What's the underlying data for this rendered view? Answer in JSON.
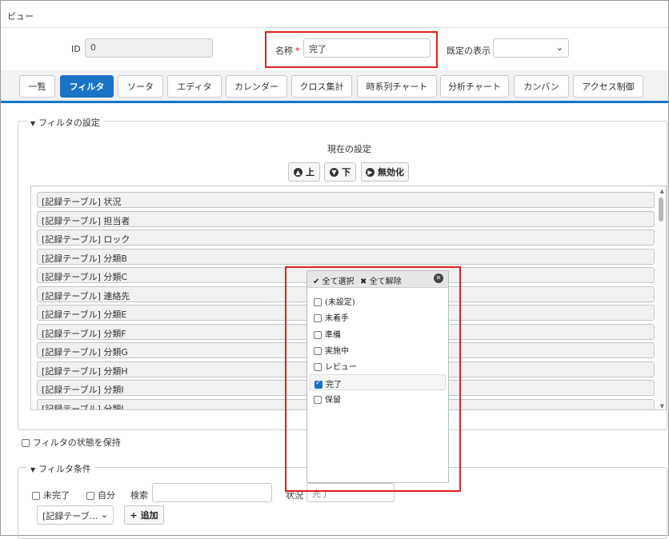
{
  "window": {
    "title": "ビュー"
  },
  "form": {
    "id_label": "ID",
    "id_value": "0",
    "name_label": "名称",
    "required_mark": "*",
    "name_value": "完了",
    "default_display_label": "既定の表示",
    "default_display_value": ""
  },
  "tabs": [
    {
      "label": "一覧",
      "active": false
    },
    {
      "label": "フィルタ",
      "active": true
    },
    {
      "label": "ソータ",
      "active": false
    },
    {
      "label": "エディタ",
      "active": false
    },
    {
      "label": "カレンダー",
      "active": false
    },
    {
      "label": "クロス集計",
      "active": false
    },
    {
      "label": "時系列チャート",
      "active": false
    },
    {
      "label": "分析チャート",
      "active": false
    },
    {
      "label": "カンバン",
      "active": false
    },
    {
      "label": "アクセス制御",
      "active": false
    }
  ],
  "filter_settings": {
    "legend": "フィルタの設定",
    "current_settings_label": "現在の設定",
    "buttons": {
      "up": "上",
      "down": "下",
      "disable": "無効化"
    },
    "items": [
      "[記録テーブル] 状況",
      "[記録テーブル] 担当者",
      "[記録テーブル] ロック",
      "[記録テーブル] 分類B",
      "[記録テーブル] 分類C",
      "[記録テーブル] 連絡先",
      "[記録テーブル] 分類E",
      "[記録テーブル] 分類F",
      "[記録テーブル] 分類G",
      "[記録テーブル] 分類H",
      "[記録テーブル] 分類I",
      "[記録テーブル] 分類J"
    ],
    "keep_state_label": "フィルタの状態を保持"
  },
  "filter_conditions": {
    "legend": "フィルタ条件",
    "incomplete_label": "未完了",
    "own_label": "自分",
    "search_label": "検索",
    "search_value": "",
    "status_label": "状況",
    "status_value": "完了",
    "column_select_value": "[記録テーブ…",
    "add_button": "追加"
  },
  "status_dropdown": {
    "select_all": "全て選択",
    "deselect_all": "全て解除",
    "options": [
      {
        "label": "(未設定)",
        "checked": false
      },
      {
        "label": "未着手",
        "checked": false
      },
      {
        "label": "準備",
        "checked": false
      },
      {
        "label": "実施中",
        "checked": false
      },
      {
        "label": "レビュー",
        "checked": false
      },
      {
        "label": "完了",
        "checked": true
      },
      {
        "label": "保留",
        "checked": false
      }
    ]
  },
  "colors": {
    "accent": "#1a73c7",
    "highlight": "#e02020"
  }
}
